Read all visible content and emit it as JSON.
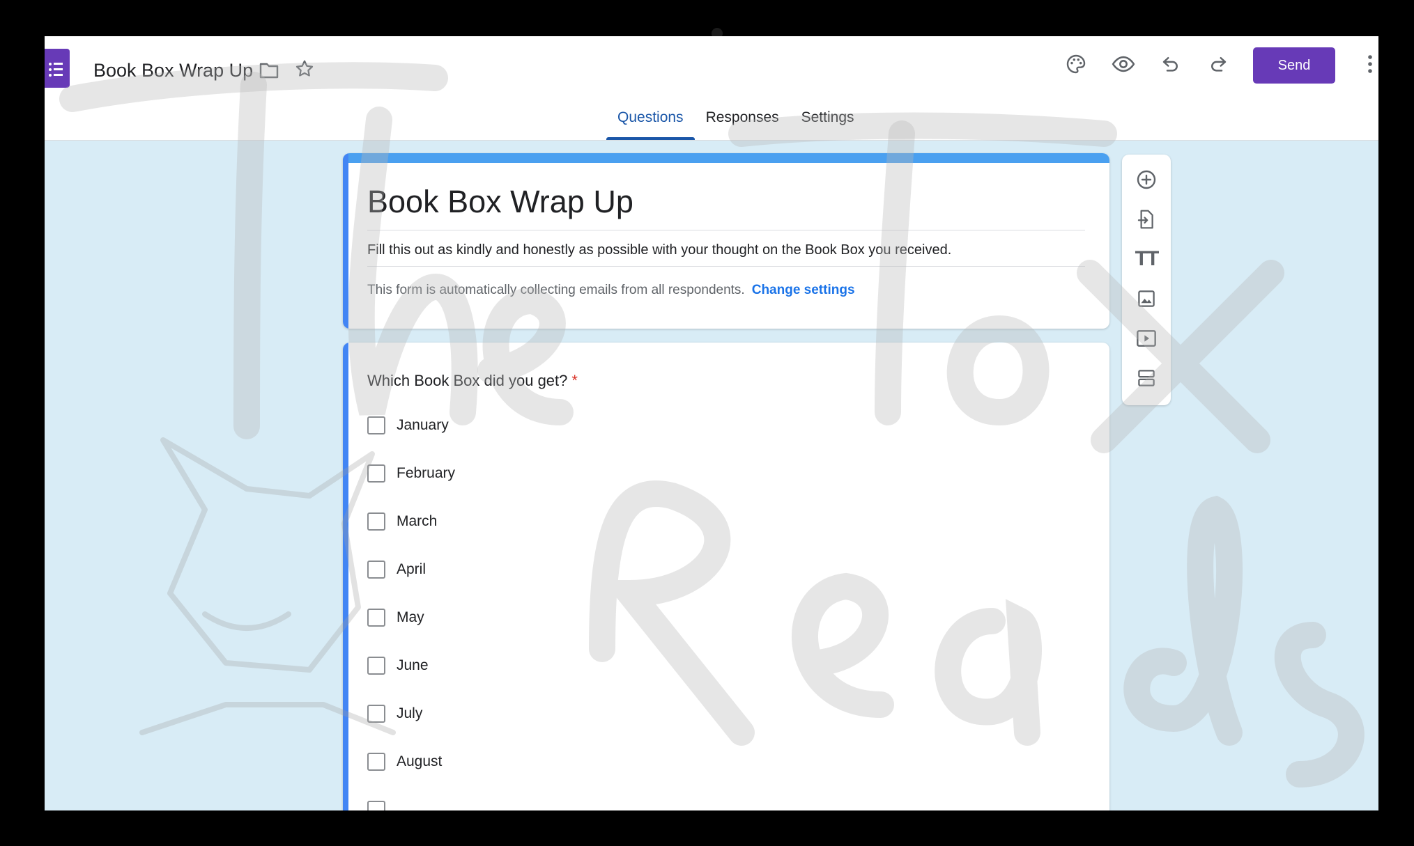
{
  "header": {
    "doc_title": "Book Box Wrap Up",
    "send_label": "Send",
    "icons": [
      "forms-app-icon",
      "folder-icon",
      "star-icon",
      "palette-icon",
      "preview-eye-icon",
      "undo-icon",
      "redo-icon",
      "more-vert-icon"
    ]
  },
  "tabs": [
    {
      "label": "Questions",
      "active": true
    },
    {
      "label": "Responses",
      "active": false
    },
    {
      "label": "Settings",
      "active": false
    }
  ],
  "form": {
    "title": "Book Box Wrap Up",
    "description": "Fill this out as kindly and honestly as possible with  your thought on the Book Box you received.",
    "email_note": "This form is automatically collecting emails from all respondents.",
    "change_settings_label": "Change settings"
  },
  "question": {
    "title": "Which Book Box did you get?",
    "required_marker": "*",
    "options": [
      "January",
      "February",
      "March",
      "April",
      "May",
      "June",
      "July",
      "August"
    ]
  },
  "toolbar": {
    "items": [
      "add-question-icon",
      "import-questions-icon",
      "add-title-icon",
      "add-image-icon",
      "add-video-icon",
      "add-section-icon"
    ],
    "title_icon_text": "TT"
  },
  "colors": {
    "accent": "#673ab7",
    "tab_active": "#1a56a8",
    "card_bar": "#4285f4",
    "link": "#1a73e8",
    "required": "#d93025",
    "page_bg": "#d8ecf6"
  }
}
